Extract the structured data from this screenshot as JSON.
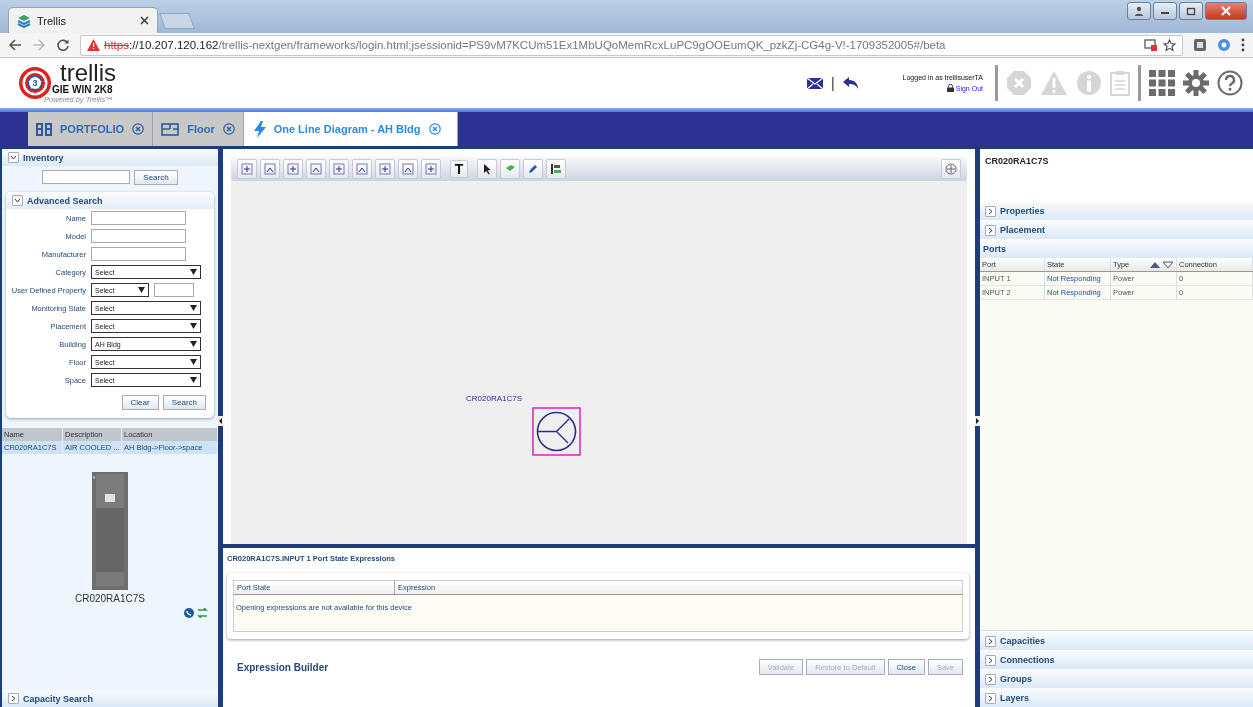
{
  "browser": {
    "tab_title": "Trellis",
    "url_scheme": "https",
    "url_host": "://10.207.120.162",
    "url_path": "/trellis-nextgen/frameworks/login.html;jsessionid=PS9vM7KCUm51Ex1MbUQoMemRcxLuPC9gOOEumQK_pzkZj-CG4g-V!-1709352005#/beta"
  },
  "header": {
    "logo_badge": "3",
    "logo_name": "trellis",
    "logo_sub": "GIE WIN 2K8",
    "powered": "Powered by Trellis™",
    "user": "Logged in as trellisuserTA",
    "sign_out": "Sign Out",
    "separator": "|"
  },
  "tabs": [
    {
      "label": "PORTFOLIO",
      "selected": false,
      "kind": "portfolio"
    },
    {
      "label": "Floor",
      "selected": false,
      "kind": "floor"
    },
    {
      "label": "One Line Diagram - AH Bldg",
      "selected": true,
      "kind": "diagram"
    }
  ],
  "left": {
    "inventory": {
      "title": "Inventory",
      "expanded": true,
      "search_button": "Search"
    },
    "advanced": {
      "title": "Advanced Search",
      "expanded": true,
      "fields": [
        {
          "label": "Name",
          "kind": "text"
        },
        {
          "label": "Model",
          "kind": "text"
        },
        {
          "label": "Manufacturer",
          "kind": "text"
        },
        {
          "label": "Category",
          "kind": "select",
          "value": "Select"
        },
        {
          "label": "User Defined Property",
          "kind": "select_pair",
          "value": "Select"
        },
        {
          "label": "Monitoring State",
          "kind": "select",
          "value": "Select"
        },
        {
          "label": "Placement",
          "kind": "select",
          "value": "Select"
        },
        {
          "label": "Building",
          "kind": "select",
          "value": "AH Bldg"
        },
        {
          "label": "Floor",
          "kind": "select",
          "value": "Select"
        },
        {
          "label": "Space",
          "kind": "select",
          "value": "Select"
        }
      ],
      "buttons": [
        "Clear",
        "Search"
      ]
    },
    "results": {
      "columns": [
        "Name",
        "Description",
        "Location"
      ],
      "rows": [
        {
          "cells": [
            "CR020RA1C7S",
            "AIR COOLED ...",
            "AH Bldg->Floor->space"
          ],
          "selected": true
        }
      ]
    },
    "device_label": "CR020RA1C7S",
    "capacity": {
      "title": "Capacity Search",
      "expanded": false
    }
  },
  "center": {
    "toolbar_text_button": "T",
    "diagram_label": "CR020RA1C7S",
    "expressions": {
      "title": "CR020RA1C7S.INPUT 1 Port State Expressions",
      "columns": [
        "Port State",
        "Expression"
      ],
      "message": "Opening expressions are not available for this device"
    },
    "builder_title": "Expression Builder",
    "buttons": [
      {
        "label": "Validate",
        "disabled": true
      },
      {
        "label": "Restore to Default",
        "disabled": true
      },
      {
        "label": "Close",
        "disabled": false
      },
      {
        "label": "Save",
        "disabled": true
      }
    ]
  },
  "right": {
    "title": "CR020RA1C7S",
    "top_sections": [
      {
        "title": "Properties",
        "expanded": false
      },
      {
        "title": "Placement",
        "expanded": false
      }
    ],
    "ports": {
      "title": "Ports",
      "columns": [
        "Port",
        "State",
        "Type",
        "Connection"
      ],
      "rows": [
        [
          "INPUT 1",
          "Not Responding",
          "Power",
          "0"
        ],
        [
          "INPUT 2",
          "Not Responding",
          "Power",
          "0"
        ]
      ]
    },
    "bottom_sections": [
      {
        "title": "Capacities",
        "expanded": false
      },
      {
        "title": "Connections",
        "expanded": false
      },
      {
        "title": "Groups",
        "expanded": false
      },
      {
        "title": "Layers",
        "expanded": false
      }
    ]
  }
}
